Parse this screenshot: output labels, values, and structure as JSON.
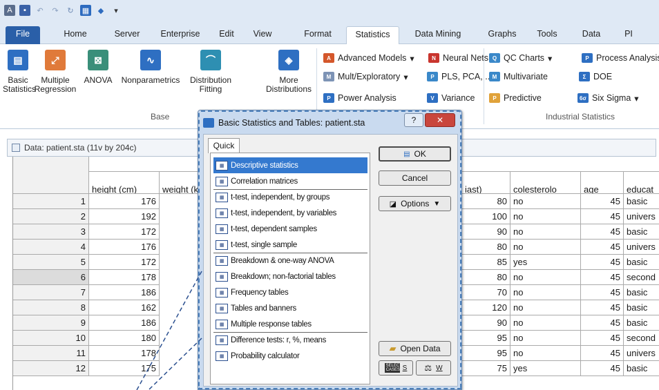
{
  "tabs": [
    "File",
    "Home",
    "Server",
    "Enterprise",
    "Edit",
    "View",
    "Format",
    "Statistics",
    "Data Mining",
    "Graphs",
    "Tools",
    "Data",
    "PI"
  ],
  "ribbon": {
    "big_buttons": [
      {
        "label_l1": "Basic",
        "label_l2": "Statistics",
        "icon": "basic-statistics-icon"
      },
      {
        "label_l1": "Multiple",
        "label_l2": "Regression",
        "icon": "multiple-regression-icon"
      },
      {
        "label_l1": "ANOVA",
        "label_l2": "",
        "icon": "anova-icon"
      },
      {
        "label_l1": "Nonparametrics",
        "label_l2": "",
        "icon": "nonparametrics-icon"
      },
      {
        "label_l1": "Distribution",
        "label_l2": "Fitting",
        "icon": "distribution-fitting-icon"
      },
      {
        "label_l1": "More",
        "label_l2": "Distributions",
        "icon": "more-distributions-icon"
      }
    ],
    "base_group_label": "Base",
    "small_buttons": [
      {
        "label": "Advanced Models",
        "dropdown": true,
        "icon": "advanced-models-icon"
      },
      {
        "label": "Neural Nets",
        "dropdown": false,
        "icon": "neural-nets-icon"
      },
      {
        "label": "Mult/Exploratory",
        "dropdown": true,
        "icon": "mult-exploratory-icon"
      },
      {
        "label": "PLS, PCA, ...",
        "dropdown": false,
        "icon": "pls-pca-icon"
      },
      {
        "label": "Power Analysis",
        "dropdown": false,
        "icon": "power-analysis-icon"
      },
      {
        "label": "Variance",
        "dropdown": false,
        "icon": "variance-icon"
      },
      {
        "label": "QC Charts",
        "dropdown": true,
        "icon": "qc-charts-icon"
      },
      {
        "label": "Process Analysis",
        "dropdown": false,
        "icon": "process-analysis-icon"
      },
      {
        "label": "Multivariate",
        "dropdown": false,
        "icon": "multivariate-icon"
      },
      {
        "label": "DOE",
        "dropdown": false,
        "icon": "doe-icon"
      },
      {
        "label": "Predictive",
        "dropdown": false,
        "icon": "predictive-icon"
      },
      {
        "label": "Six Sigma",
        "dropdown": true,
        "icon": "six-sigma-icon"
      }
    ],
    "industrial_group_label": "Industrial Statistics"
  },
  "sheet": {
    "title": "Data: patient.sta (11v by 204c)",
    "columns": [
      "height (cm)",
      "weight (k",
      "",
      "",
      "",
      "iast)",
      "colesterolo",
      "age",
      "educat"
    ],
    "rows": [
      {
        "n": "1",
        "height": "176",
        "bp": "80",
        "chol": "no",
        "age": "45",
        "edu": "basic"
      },
      {
        "n": "2",
        "height": "192",
        "bp": "100",
        "chol": "no",
        "age": "45",
        "edu": "univers"
      },
      {
        "n": "3",
        "height": "172",
        "bp": "90",
        "chol": "no",
        "age": "45",
        "edu": "basic"
      },
      {
        "n": "4",
        "height": "176",
        "bp": "80",
        "chol": "no",
        "age": "45",
        "edu": "univers"
      },
      {
        "n": "5",
        "height": "172",
        "bp": "85",
        "chol": "yes",
        "age": "45",
        "edu": "basic"
      },
      {
        "n": "6",
        "height": "178",
        "bp": "80",
        "chol": "no",
        "age": "45",
        "edu": "second"
      },
      {
        "n": "7",
        "height": "186",
        "bp": "70",
        "chol": "no",
        "age": "45",
        "edu": "basic"
      },
      {
        "n": "8",
        "height": "162",
        "bp": "120",
        "chol": "no",
        "age": "45",
        "edu": "basic"
      },
      {
        "n": "9",
        "height": "186",
        "bp": "90",
        "chol": "no",
        "age": "45",
        "edu": "basic"
      },
      {
        "n": "10",
        "height": "180",
        "bp": "95",
        "chol": "no",
        "age": "45",
        "edu": "second"
      },
      {
        "n": "11",
        "height": "178",
        "bp": "95",
        "chol": "no",
        "age": "45",
        "edu": "univers"
      },
      {
        "n": "12",
        "height": "175",
        "bp": "75",
        "chol": "yes",
        "age": "45",
        "edu": "basic"
      }
    ]
  },
  "dialog": {
    "title": "Basic Statistics and Tables: patient.sta",
    "help_label": "?",
    "close_label": "✕",
    "tab_label": "Quick",
    "items": [
      {
        "label": "Descriptive statistics",
        "selected": true,
        "sep": false
      },
      {
        "label": "Correlation matrices",
        "selected": false,
        "sep": false
      },
      {
        "label": "t-test, independent, by groups",
        "selected": false,
        "sep": true
      },
      {
        "label": "t-test, independent, by variables",
        "selected": false,
        "sep": false
      },
      {
        "label": "t-test, dependent samples",
        "selected": false,
        "sep": false
      },
      {
        "label": "t-test, single sample",
        "selected": false,
        "sep": false
      },
      {
        "label": "Breakdown & one-way ANOVA",
        "selected": false,
        "sep": true
      },
      {
        "label": "Breakdown; non-factorial tables",
        "selected": false,
        "sep": false
      },
      {
        "label": "Frequency tables",
        "selected": false,
        "sep": false
      },
      {
        "label": "Tables and banners",
        "selected": false,
        "sep": false
      },
      {
        "label": "Multiple response tables",
        "selected": false,
        "sep": false
      },
      {
        "label": "Difference tests: r, %, means",
        "selected": false,
        "sep": true
      },
      {
        "label": "Probability calculator",
        "selected": false,
        "sep": false
      }
    ],
    "ok_label": "OK",
    "cancel_label": "Cancel",
    "options_label": "Options",
    "open_data_label": "Open Data",
    "select_cases_icon_text": "SELECT CASES",
    "select_cases_key": "S",
    "weights_key": "W"
  }
}
